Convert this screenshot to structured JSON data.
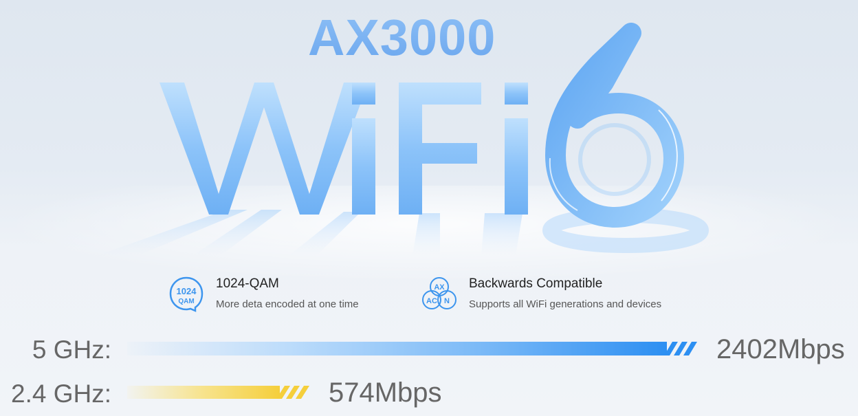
{
  "hero": {
    "model": "AX3000",
    "wifi_text": "WiFi",
    "gen_number": "6",
    "colors": {
      "primary_blue": "#6aa6ee",
      "light_blue": "#a8d0fb"
    }
  },
  "features": [
    {
      "icon": "qam-badge-icon",
      "icon_top": "1024",
      "icon_bottom": "QAM",
      "title": "1024-QAM",
      "subtitle": "More deta encoded at one time"
    },
    {
      "icon": "ax-ac-n-icon",
      "icon_labels": [
        "AX",
        "AC",
        "N"
      ],
      "title": "Backwards Compatible",
      "subtitle": "Supports all WiFi generations and devices"
    }
  ],
  "bands": [
    {
      "label": "5 GHz:",
      "value": "2402Mbps",
      "color": "#2d8ff2"
    },
    {
      "label": "2.4 GHz:",
      "value": "574Mbps",
      "color": "#f5cf3c"
    }
  ]
}
